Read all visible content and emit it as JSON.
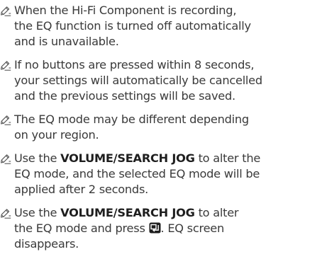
{
  "notes": [
    {
      "icon": "note-pencil-icon",
      "lines": [
        [
          {
            "text": "When the Hi-Fi Component is recording,"
          }
        ],
        [
          {
            "text": "the EQ function is turned off automatically"
          }
        ],
        [
          {
            "text": "and is unavailable."
          }
        ]
      ]
    },
    {
      "icon": "note-pencil-icon",
      "lines": [
        [
          {
            "text": "If no buttons are pressed within 8 seconds,"
          }
        ],
        [
          {
            "text": "your settings will automatically be cancelled"
          }
        ],
        [
          {
            "text": "and the previous settings will be saved."
          }
        ]
      ]
    },
    {
      "icon": "note-pencil-icon",
      "lines": [
        [
          {
            "text": "The EQ mode may be different depending"
          }
        ],
        [
          {
            "text": "on your region."
          }
        ]
      ]
    },
    {
      "icon": "note-pencil-icon",
      "lines": [
        [
          {
            "text": "Use the "
          },
          {
            "text": "VOLUME/SEARCH JOG",
            "bold": true
          },
          {
            "text": " to alter the"
          }
        ],
        [
          {
            "text": "EQ mode, and the selected EQ mode will be"
          }
        ],
        [
          {
            "text": "applied after 2 seconds."
          }
        ]
      ]
    },
    {
      "icon": "note-pencil-icon",
      "lines": [
        [
          {
            "text": "Use the "
          },
          {
            "text": "VOLUME/SEARCH JOG",
            "bold": true
          },
          {
            "text": " to alter"
          }
        ],
        [
          {
            "text": "the EQ mode and press "
          },
          {
            "icon": "enter-key-icon"
          },
          {
            "text": ". EQ screen"
          }
        ],
        [
          {
            "text": "disappears."
          }
        ]
      ]
    }
  ]
}
